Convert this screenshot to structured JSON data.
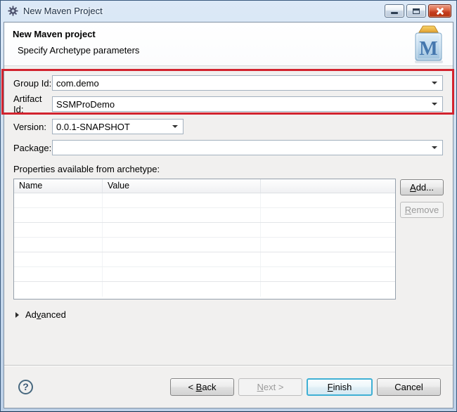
{
  "window": {
    "title": "New Maven Project"
  },
  "header": {
    "title": "New Maven project",
    "subtitle": "Specify Archetype parameters",
    "logo_letter": "M"
  },
  "form": {
    "group_id": {
      "label": "Group Id:",
      "value": "com.demo"
    },
    "artifact_id": {
      "label": "Artifact Id:",
      "value": "SSMProDemo"
    },
    "version": {
      "label": "Version:",
      "value": "0.0.1-SNAPSHOT"
    },
    "package": {
      "label": "Package:",
      "value": ""
    }
  },
  "properties": {
    "label": "Properties available from archetype:",
    "table": {
      "columns": [
        "Name",
        "Value",
        ""
      ]
    },
    "buttons": {
      "add": {
        "pre": "",
        "m": "A",
        "post": "dd..."
      },
      "remove": {
        "pre": "",
        "m": "R",
        "post": "emove"
      }
    }
  },
  "advanced": {
    "pre": "Ad",
    "m": "v",
    "post": "anced"
  },
  "footer": {
    "help": "?",
    "back": {
      "pre": "< ",
      "m": "B",
      "post": "ack"
    },
    "next": {
      "pre": "",
      "m": "N",
      "post": "ext >"
    },
    "finish": {
      "pre": "",
      "m": "F",
      "post": "inish"
    },
    "cancel": {
      "label": "Cancel"
    }
  },
  "colors": {
    "highlight_red": "#d2232e",
    "titlebar_blue": "#cbdcee",
    "finish_accent": "#3fb0d4",
    "close_button_red": "#c43d20",
    "dialog_background": "#f1f0ef"
  }
}
